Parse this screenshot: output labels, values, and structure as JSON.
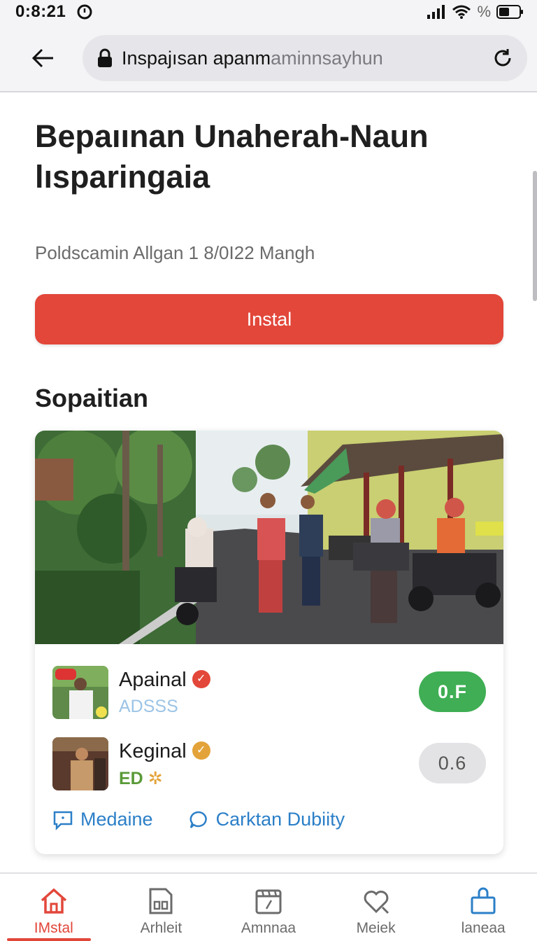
{
  "status": {
    "time": "0:8:21",
    "battery_text": "%"
  },
  "browser": {
    "url_main": "Inspajısan apanm",
    "url_dim": "aminnsayhun"
  },
  "page": {
    "title": "Bepaıınan Unaherah-Naun lısparingaia",
    "meta": "Poldscamin Allgan 1 8/0I22 Mangh",
    "install_label": "Instal",
    "section_heading": "Sopaitian"
  },
  "card": {
    "rows": [
      {
        "name": "Apainal",
        "sub": "ADSSS",
        "score": "0.F",
        "badge_color": "#e2473a",
        "score_color": "#3fae54"
      },
      {
        "name": "Keginal",
        "sub": "ED",
        "score": "0.6",
        "badge_color": "#e3a33a",
        "score_color": "#e3e3e6"
      }
    ],
    "actions": [
      {
        "label": "Medaine",
        "icon": "chat-square-icon"
      },
      {
        "label": "Carktan Dubiity",
        "icon": "chat-bubble-icon"
      }
    ]
  },
  "nav": {
    "items": [
      {
        "label": "IMstal",
        "icon": "home-icon",
        "active": true
      },
      {
        "label": "Arhleit",
        "icon": "document-icon",
        "active": false
      },
      {
        "label": "Amnnaa",
        "icon": "calendar-icon",
        "active": false
      },
      {
        "label": "Meiek",
        "icon": "heart-icon",
        "active": false
      },
      {
        "label": "laneaa",
        "icon": "bag-icon",
        "active": false
      }
    ]
  },
  "colors": {
    "accent": "#e2473a",
    "link": "#2b7fc7",
    "success": "#3fae54"
  }
}
